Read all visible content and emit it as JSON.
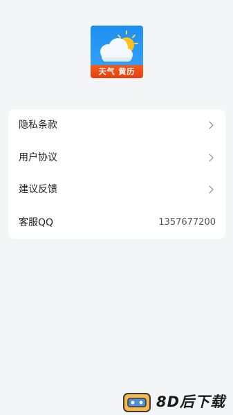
{
  "logo": {
    "banner_text": "天气 黄历"
  },
  "menu": {
    "items": [
      {
        "label": "隐私条款",
        "chevron": "chevron-right-icon"
      },
      {
        "label": "用户协议",
        "chevron": "chevron-right-icon"
      },
      {
        "label": "建议反馈",
        "chevron": "chevron-right-icon"
      },
      {
        "label": "客服QQ",
        "value": "1357677200"
      }
    ]
  },
  "watermark": {
    "text": "8D后下载"
  },
  "colors": {
    "background": "#f4f5f7",
    "card": "#ffffff",
    "logo_blue": "#2c9bf5",
    "logo_banner": "#e5400f",
    "sun": "#ffc21a"
  }
}
